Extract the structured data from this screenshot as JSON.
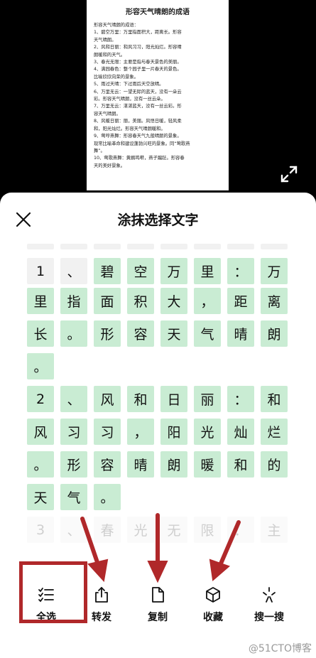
{
  "document": {
    "title": "形容天气晴朗的成语",
    "lines": [
      "形容天气晴朗的成语：",
      "1、碧空万里：万里指面积大，距离长。形容",
      "天气晴朗。",
      "2、风和日丽：和风习习，阳光灿烂。形容晴",
      "朗暖和的天气。",
      "3、春光无限：主要是指与春天景色的美丽。",
      "4、满园春色：整个园子里一片春天的景色。",
      "比喻欣欣向荣的景象。",
      "5、雨过天晴：下过雨后天空放晴。",
      "6、万里无云：一望无际的蓝天，没有一朵云",
      "彩。形容天气晴朗，没有一丝云朵。",
      "7、万里无云：湛湛蓝天，没有一丝云彩。形",
      "容天气晴朗。",
      "8、风暖日丽：丽，美丽。风悟日暖，轻风柔",
      "和，阳光灿烂。形容天气晴朗暖和。",
      "9、莺哼燕舞：形容春天气九般晴朗的景象。",
      "现常比喻革命和建设蓬勃兴旺的景象。同“莺歌燕",
      "舞”。",
      "10、莺歌燕舞：黄鹂鸣啭，燕子蹁跹。形容春",
      "天的美好景象。"
    ]
  },
  "sheet": {
    "title": "涂抹选择文字",
    "rows": [
      {
        "chars": [
          "1",
          "、",
          "碧",
          "空",
          "万",
          "里",
          "：",
          "万"
        ],
        "selected": [
          false,
          false,
          true,
          true,
          true,
          true,
          true,
          true
        ]
      },
      {
        "chars": [
          "里",
          "指",
          "面",
          "积",
          "大",
          "，",
          "距",
          "离"
        ],
        "selected": [
          true,
          true,
          true,
          true,
          true,
          true,
          true,
          true
        ]
      },
      {
        "chars": [
          "长",
          "。",
          "形",
          "容",
          "天",
          "气",
          "晴",
          "朗"
        ],
        "selected": [
          true,
          true,
          true,
          true,
          true,
          true,
          true,
          true
        ]
      },
      {
        "chars": [
          "。"
        ],
        "selected": [
          true
        ]
      },
      {
        "chars": [
          "2",
          "、",
          "风",
          "和",
          "日",
          "丽",
          "：",
          "和"
        ],
        "selected": [
          true,
          true,
          true,
          true,
          true,
          true,
          true,
          true
        ]
      },
      {
        "chars": [
          "风",
          "习",
          "习",
          "，",
          "阳",
          "光",
          "灿",
          "烂"
        ],
        "selected": [
          true,
          true,
          true,
          true,
          true,
          true,
          true,
          true
        ]
      },
      {
        "chars": [
          "。",
          "形",
          "容",
          "晴",
          "朗",
          "暖",
          "和",
          "的"
        ],
        "selected": [
          true,
          true,
          true,
          true,
          true,
          true,
          true,
          true
        ]
      },
      {
        "chars": [
          "天",
          "气",
          "。"
        ],
        "selected": [
          true,
          true,
          true
        ]
      },
      {
        "chars": [
          "3",
          "、",
          "春",
          "光",
          "无",
          "限",
          "：",
          "主"
        ],
        "selected": [
          false,
          false,
          false,
          false,
          false,
          false,
          false,
          false
        ]
      }
    ]
  },
  "toolbar": {
    "items": [
      {
        "label": "全选",
        "icon": "select-all-icon"
      },
      {
        "label": "转发",
        "icon": "share-icon"
      },
      {
        "label": "复制",
        "icon": "copy-icon"
      },
      {
        "label": "收藏",
        "icon": "favorite-cube-icon"
      },
      {
        "label": "搜一搜",
        "icon": "search-sparkle-icon"
      }
    ]
  },
  "colors": {
    "selected_chip": "#c9ecd3",
    "annotation_red": "#b0282a"
  },
  "watermark": "@51CTO博客"
}
